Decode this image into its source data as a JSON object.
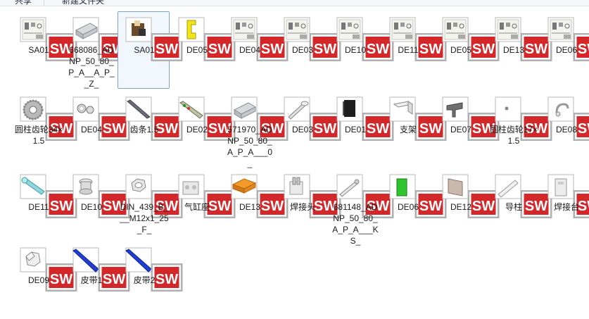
{
  "toolbar": {
    "items": [
      "共享",
      "新建文件夹"
    ]
  },
  "colors": {
    "selection_border": "#7da2ce",
    "selection_fill": "#f2f7fd",
    "sw_red": "#d3272a"
  },
  "files": [
    {
      "label": "SA01",
      "icon": "drawing-sheet-icon"
    },
    {
      "label": "668086_ADNP_50_80_P_A__A_P__Z_",
      "icon": "cylinder-part-icon"
    },
    {
      "label": "SA01",
      "icon": "assembly-icon",
      "selected": true
    },
    {
      "label": "DE05",
      "icon": "yellow-bracket-icon"
    },
    {
      "label": "DE04",
      "icon": "drawing-sheet-icon"
    },
    {
      "label": "DE03",
      "icon": "drawing-sheet-icon"
    },
    {
      "label": "DE10",
      "icon": "drawing-sheet-icon"
    },
    {
      "label": "DE11",
      "icon": "drawing-sheet-icon"
    },
    {
      "label": "DE05",
      "icon": "drawing-sheet-icon"
    },
    {
      "label": "DE13",
      "icon": "drawing-sheet-icon"
    },
    {
      "label": "DE06",
      "icon": "drawing-sheet-icon"
    },
    {
      "label": "圆柱齿轮34×1.5",
      "icon": "gear-icon"
    },
    {
      "label": "DE04",
      "icon": "link-part-icon"
    },
    {
      "label": "齿条1.5",
      "icon": "rack-icon"
    },
    {
      "label": "DE02",
      "icon": "rail-part-icon"
    },
    {
      "label": "571970_ADNP_50_80_A_P_A___0_",
      "icon": "cylinder-part-icon"
    },
    {
      "label": "DE03",
      "icon": "shaft-icon"
    },
    {
      "label": "DE01",
      "icon": "black-block-icon"
    },
    {
      "label": "支架",
      "icon": "bracket-icon"
    },
    {
      "label": "DE07",
      "icon": "clamp-part-icon"
    },
    {
      "label": "圆柱齿轮17×1.5",
      "icon": "small-gear-icon"
    },
    {
      "label": "DE08",
      "icon": "hook-part-icon"
    },
    {
      "label": "DE11",
      "icon": "cyan-arm-icon"
    },
    {
      "label": "DE10",
      "icon": "spool-part-icon"
    },
    {
      "label": "DIN_439_B___M12x1_25_F_",
      "icon": "nut-icon"
    },
    {
      "label": "气缸座",
      "icon": "cylinder-seat-icon"
    },
    {
      "label": "DE13",
      "icon": "orange-plate-icon"
    },
    {
      "label": "焊接头",
      "icon": "weld-head-icon"
    },
    {
      "label": "681148_ADNP_50_80_A_P_A___KS_",
      "icon": "rod-part-icon"
    },
    {
      "label": "DE06",
      "icon": "green-block-icon"
    },
    {
      "label": "DE12",
      "icon": "plate-part-icon"
    },
    {
      "label": "导柱",
      "icon": "guide-pillar-icon"
    },
    {
      "label": "焊接台",
      "icon": "weld-table-icon"
    },
    {
      "label": "DE09",
      "icon": "hex-part-icon"
    },
    {
      "label": "皮带1",
      "icon": "blue-belt-icon"
    },
    {
      "label": "皮带2",
      "icon": "blue-belt-icon"
    }
  ]
}
